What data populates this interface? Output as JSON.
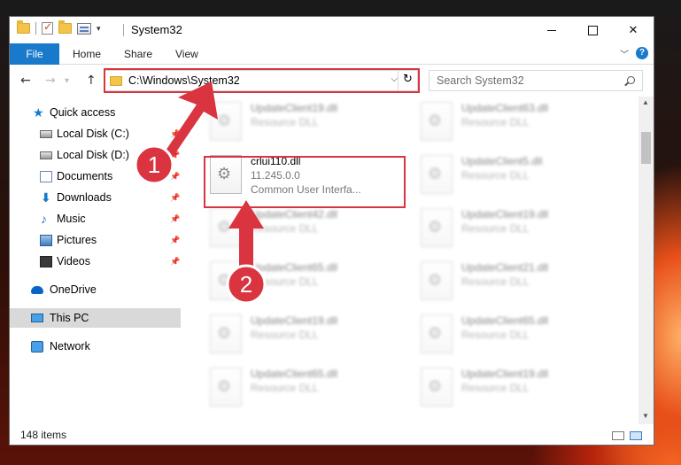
{
  "window": {
    "title": "System32"
  },
  "ribbon": {
    "tabs": [
      "File",
      "Home",
      "Share",
      "View"
    ],
    "help": "?"
  },
  "address": {
    "path": "C:\\Windows\\System32"
  },
  "search": {
    "placeholder": "Search System32"
  },
  "nav": {
    "items": [
      {
        "label": "Quick access",
        "icon": "star-icon"
      },
      {
        "label": "Local Disk (C:)",
        "icon": "disk-icon"
      },
      {
        "label": "Local Disk (D:)",
        "icon": "disk-icon"
      },
      {
        "label": "Documents",
        "icon": "documents-icon"
      },
      {
        "label": "Downloads",
        "icon": "downloads-icon"
      },
      {
        "label": "Music",
        "icon": "music-icon"
      },
      {
        "label": "Pictures",
        "icon": "pictures-icon"
      },
      {
        "label": "Videos",
        "icon": "videos-icon"
      },
      {
        "label": "OneDrive",
        "icon": "onedrive-icon"
      },
      {
        "label": "This PC",
        "icon": "this-pc-icon",
        "selected": true
      },
      {
        "label": "Network",
        "icon": "network-icon"
      }
    ]
  },
  "files": [
    {
      "name": "UpdateClient19.dll",
      "desc": "Resource DLL"
    },
    {
      "name": "UpdateClient63.dll",
      "desc": "Resource DLL"
    },
    {
      "name": "crlui110.dll",
      "version": "11.245.0.0",
      "desc": "Common User Interfa...",
      "highlighted": true
    },
    {
      "name": "UpdateClient5.dll",
      "desc": "Resource DLL"
    },
    {
      "name": "UpdateClient42.dll",
      "desc": "Resource DLL"
    },
    {
      "name": "UpdateClient19.dll",
      "desc": "Resource DLL"
    },
    {
      "name": "UpdateClient65.dll",
      "desc": "Resource DLL"
    },
    {
      "name": "UpdateClient21.dll",
      "desc": "Resource DLL"
    },
    {
      "name": "UpdateClient19.dll",
      "desc": "Resource DLL"
    },
    {
      "name": "UpdateClient65.dll",
      "desc": "Resource DLL"
    },
    {
      "name": "UpdateClient65.dll",
      "desc": "Resource DLL"
    },
    {
      "name": "UpdateClient19.dll",
      "desc": "Resource DLL"
    }
  ],
  "status": {
    "count": "148 items"
  },
  "callouts": [
    {
      "number": "1"
    },
    {
      "number": "2"
    }
  ],
  "colors": {
    "accent": "#1979ca",
    "highlight": "#d9343f",
    "callout": "#d9343f"
  }
}
